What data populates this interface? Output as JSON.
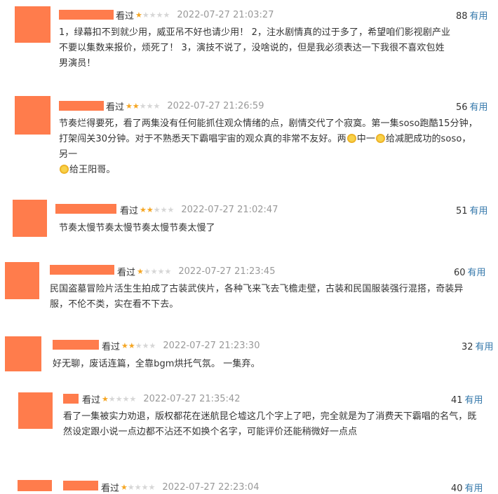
{
  "reviews": [
    {
      "watched": "看过",
      "rating": 1,
      "date": "2022-07-27 21:03:27",
      "votes": "88",
      "useful": "有用",
      "content": "1，绿幕扣不到就少用，威亚吊不好也请少用！ 2，注水剧情真的过于多了，希望咱们影视剧产业不要以集数来报价，烦死了！ 3，演技不说了，没啥说的，但是我必须表达一下我很不喜欢包姓男演员！"
    },
    {
      "watched": "看过",
      "rating": 2,
      "date": "2022-07-27 21:26:59",
      "votes": "56",
      "useful": "有用",
      "content_a": "节奏烂得要死，看了两集没有任何能抓住观众情绪的点，剧情交代了个寂寞。第一集soso跑酷15分钟，打架闯关30分钟。对于不熟悉天下霸唱宇宙的观众真的非常不友好。两",
      "content_b": "中一",
      "content_c": "给减肥成功的soso，另一",
      "content_d": "给王阳哥。"
    },
    {
      "watched": "看过",
      "rating": 2,
      "date": "2022-07-27 21:02:47",
      "votes": "51",
      "useful": "有用",
      "content": "节奏太慢节奏太慢节奏太慢节奏太慢了"
    },
    {
      "watched": "看过",
      "rating": 1,
      "date": "2022-07-27 21:23:45",
      "votes": "60",
      "useful": "有用",
      "content": "民国盗墓冒险片活生生拍成了古装武侠片，各种飞来飞去飞檐走壁，古装和民国服装强行混搭，奇装异服，不伦不类，实在看不下去。"
    },
    {
      "watched": "看过",
      "rating": 2,
      "date": "2022-07-27 21:23:30",
      "votes": "32",
      "useful": "有用",
      "content": "好无聊，废话连篇，全靠bgm烘托气氛。 一集弃。"
    },
    {
      "watched": "看过",
      "rating": 1,
      "date": "2022-07-27 21:35:42",
      "votes": "41",
      "useful": "有用",
      "content": "看了一集被实力劝退，版权都花在迷航昆仑墟这几个字上了吧，完全就是为了消费天下霸唱的名气，既然设定跟小说一点边都不沾还不如换个名字，可能评价还能稍微好一点点"
    },
    {
      "watched": "看过",
      "rating": 1,
      "date": "2022-07-27 22:23:04",
      "votes": "40",
      "useful": "有用",
      "content": ""
    }
  ],
  "colors": {
    "avatar": "#ff7c4c",
    "star_on": "#f5a623",
    "star_off": "#d6d6d6",
    "link": "#3377aa",
    "date": "#999999"
  }
}
